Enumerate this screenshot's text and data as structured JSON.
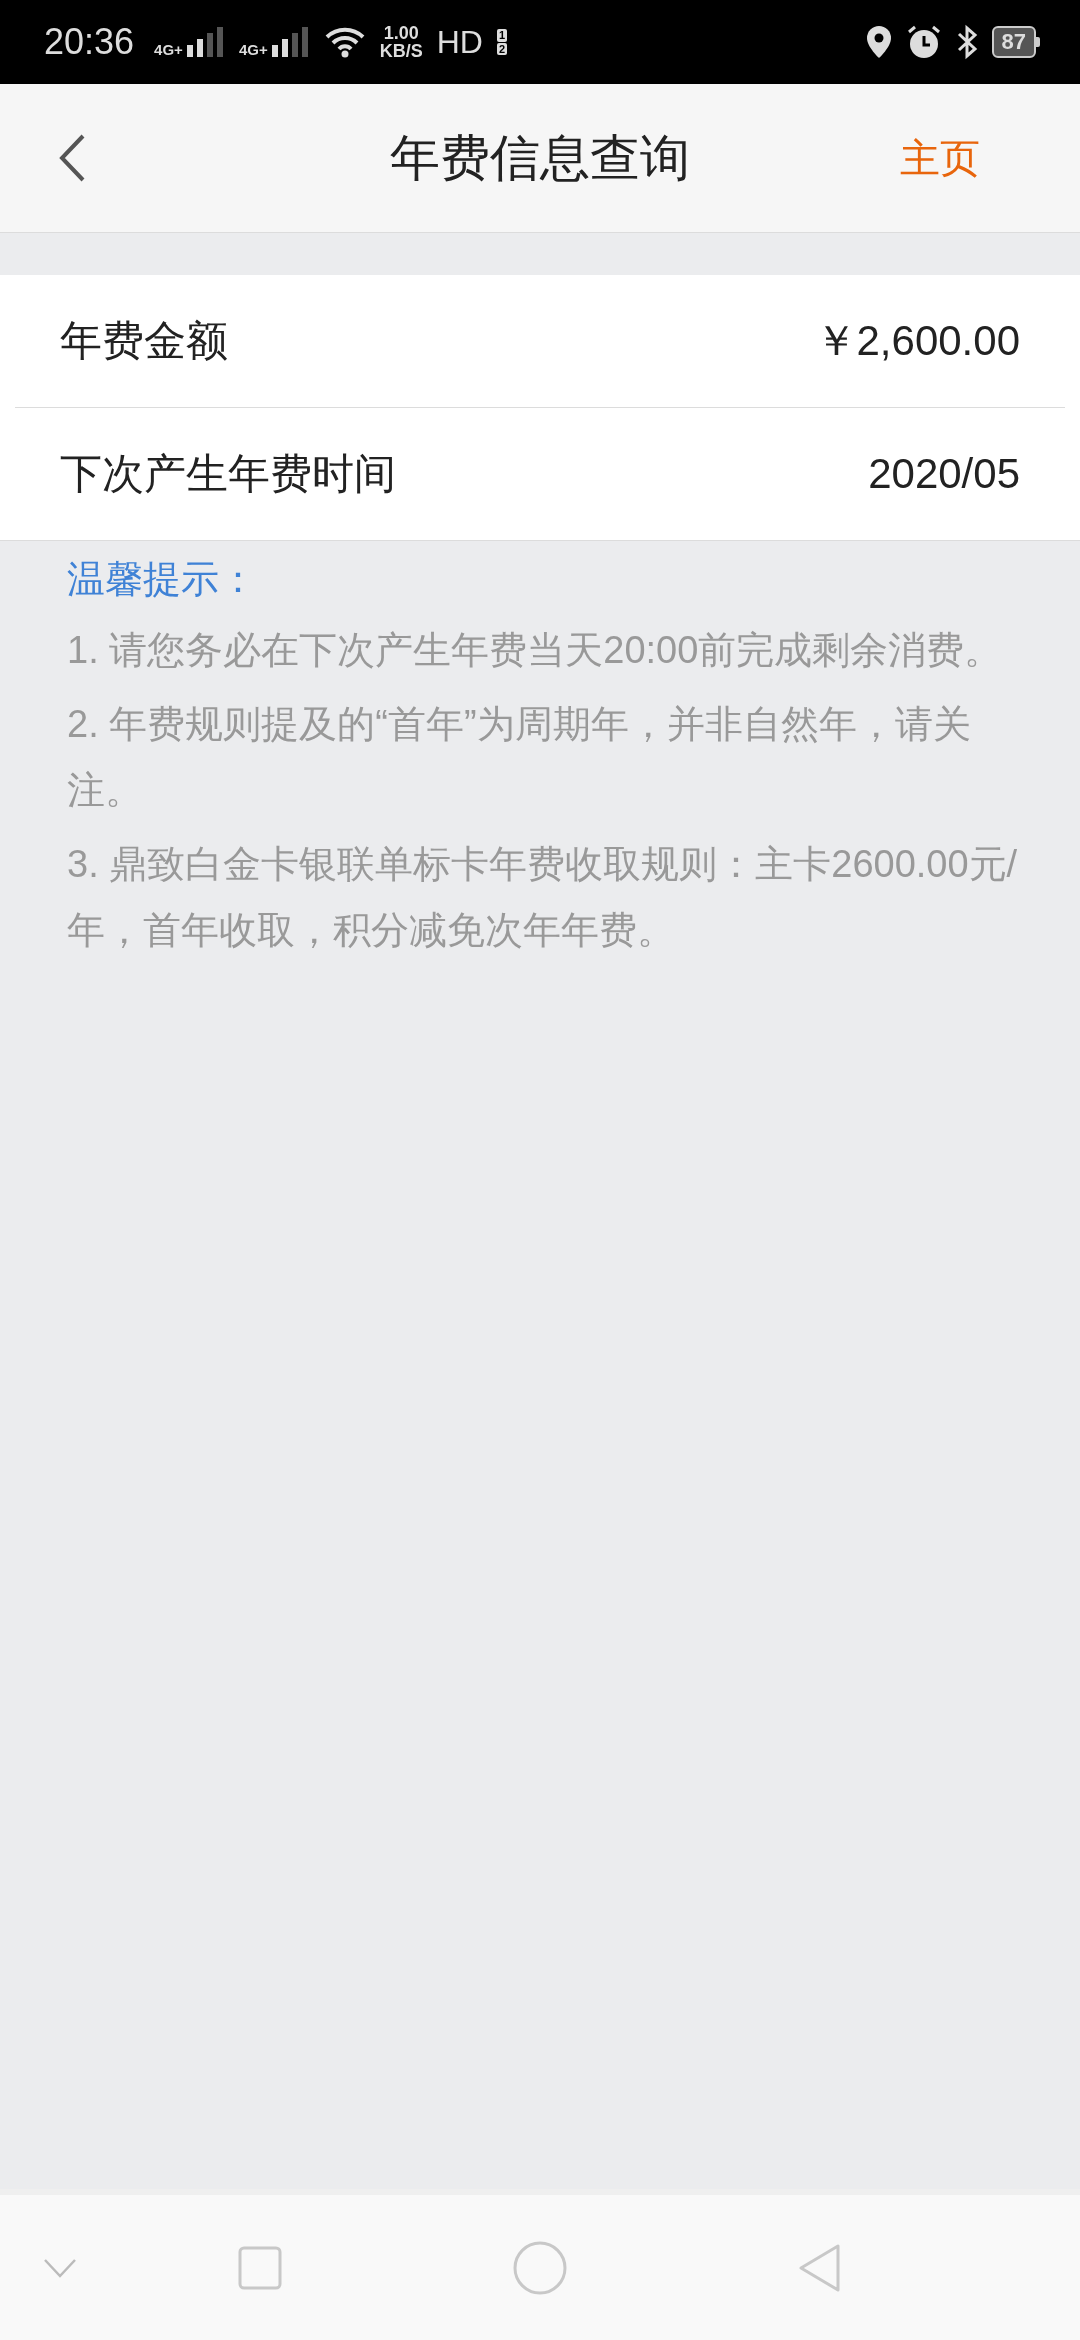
{
  "status_bar": {
    "time": "20:36",
    "sims": [
      {
        "label": "4G+"
      },
      {
        "label": "4G+"
      }
    ],
    "speed_value": "1.00",
    "speed_unit": "KB/S",
    "hd": "HD",
    "hd_slots": [
      "1",
      "2"
    ],
    "battery": "87"
  },
  "header": {
    "title": "年费信息查询",
    "home_link": "主页"
  },
  "info_rows": [
    {
      "label": "年费金额",
      "value": "￥2,600.00"
    },
    {
      "label": "下次产生年费时间",
      "value": "2020/05"
    }
  ],
  "tips": {
    "title": "温馨提示：",
    "items": [
      "1. 请您务必在下次产生年费当天20:00前完成剩余消费。",
      "2. 年费规则提及的“首年”为周期年，并非自然年，请关注。",
      "3. 鼎致白金卡银联单标卡年费收取规则：主卡2600.00元/年，首年收取，积分减免次年年费。"
    ]
  }
}
